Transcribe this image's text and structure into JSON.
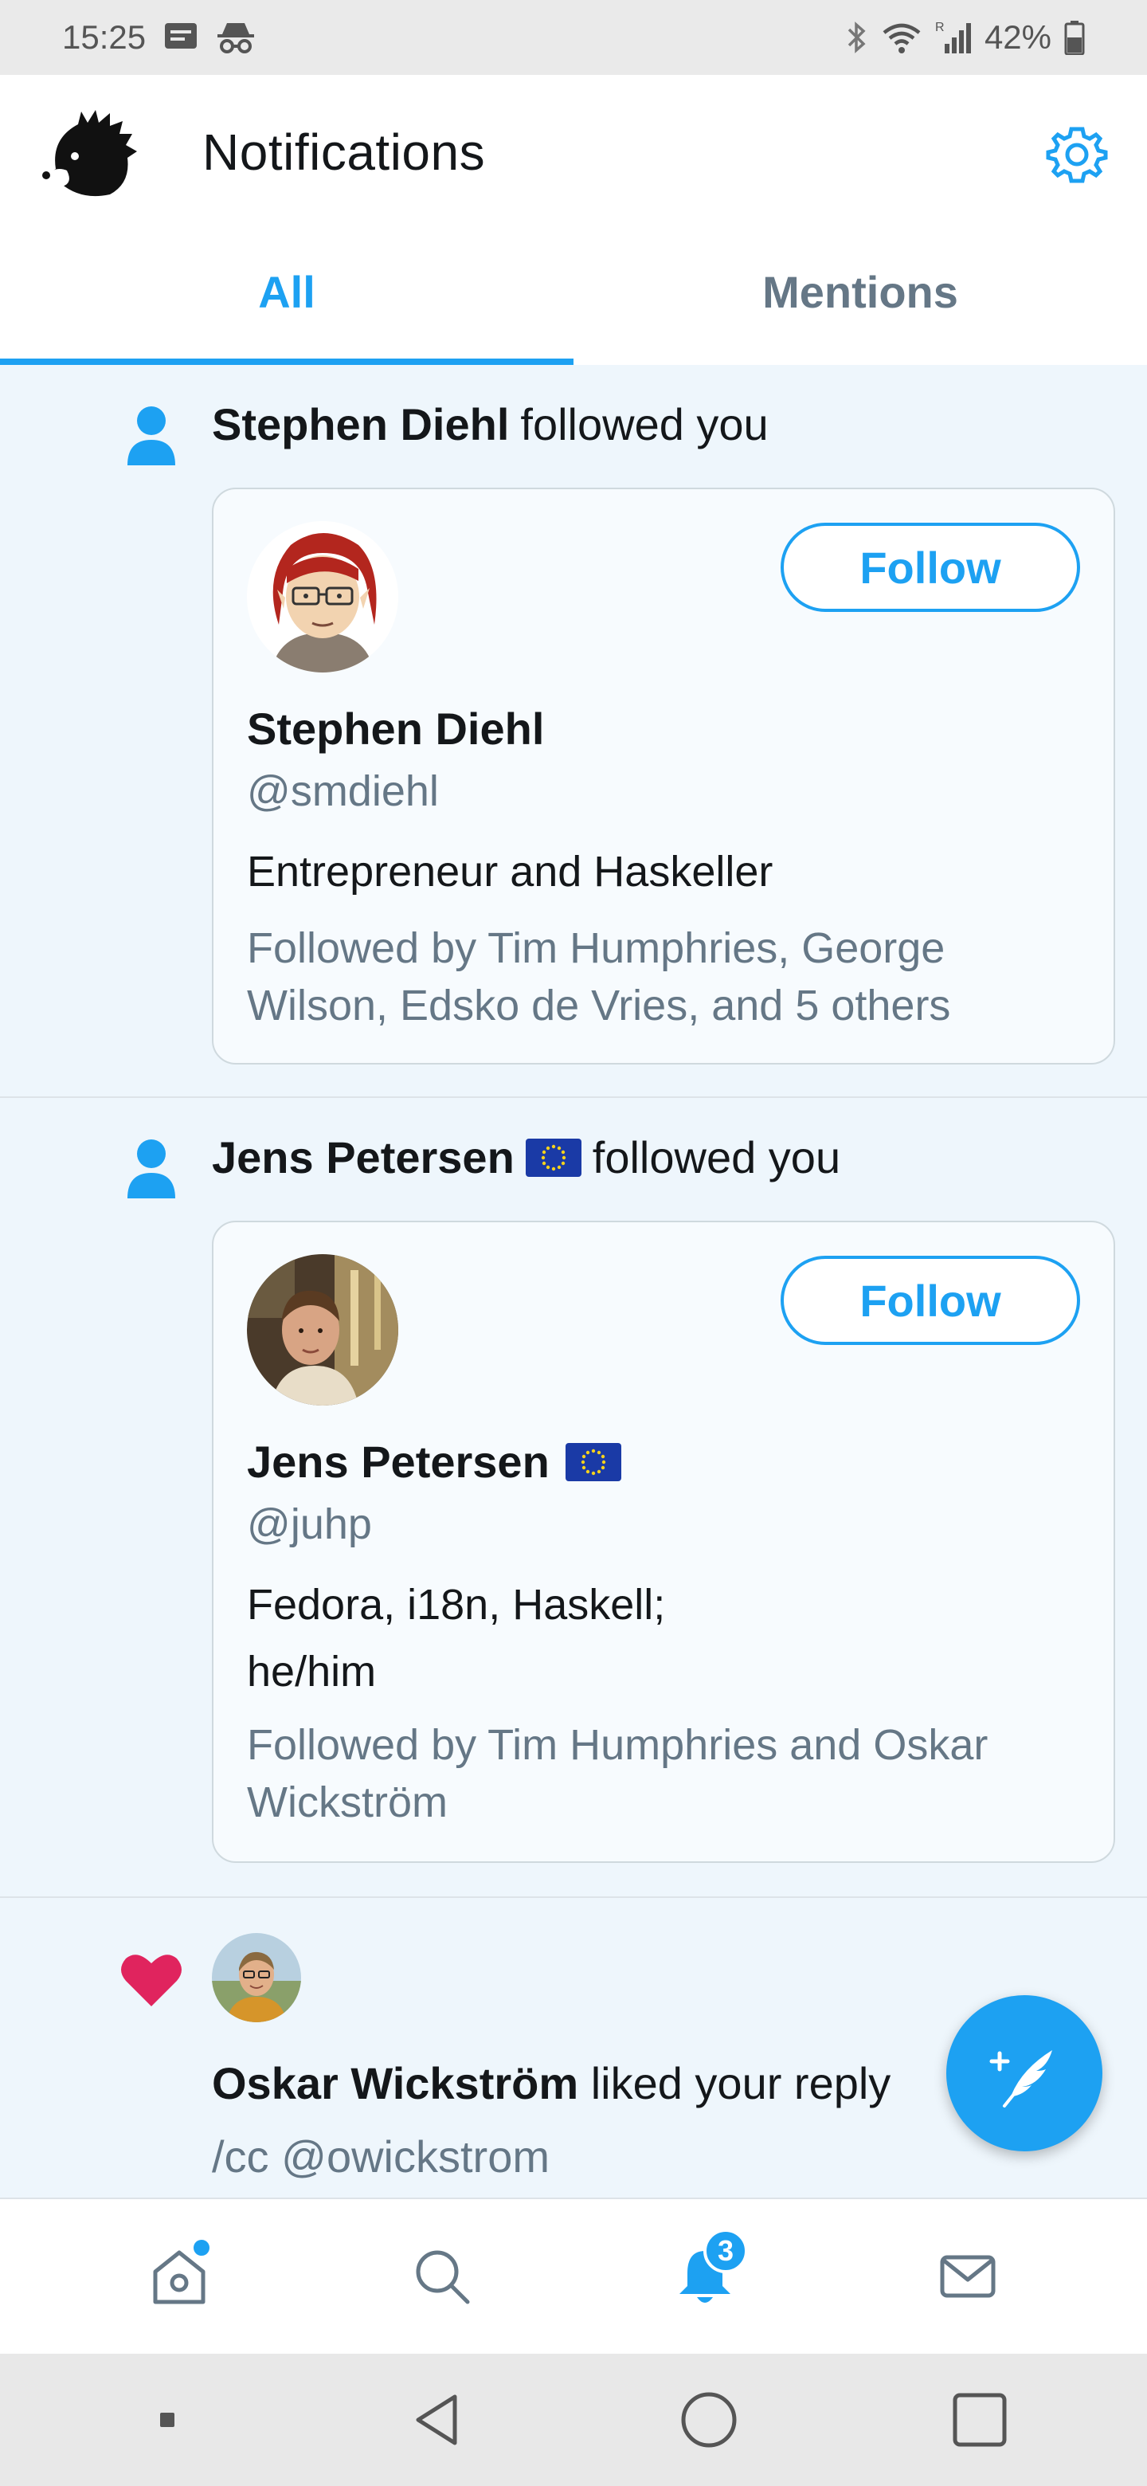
{
  "status_bar": {
    "time": "15:25",
    "battery": "42%",
    "network_label": "R"
  },
  "header": {
    "title": "Notifications"
  },
  "tabs": [
    {
      "label": "All",
      "active": true
    },
    {
      "label": "Mentions",
      "active": false
    }
  ],
  "notifications": [
    {
      "type": "follow",
      "user_name": "Stephen Diehl",
      "action_text": "followed you",
      "card": {
        "name": "Stephen Diehl",
        "handle": "@smdiehl",
        "bio": "Entrepreneur and Haskeller",
        "followed_by": "Followed by Tim Humphries, George Wilson, Edsko de Vries, and 5 others",
        "follow_label": "Follow"
      }
    },
    {
      "type": "follow",
      "user_name": "Jens Petersen",
      "action_text": "followed you",
      "card": {
        "name": "Jens Petersen",
        "handle": "@juhp",
        "bio_line1": "Fedora, i18n, Haskell;",
        "bio_line2": "he/him",
        "followed_by": "Followed by Tim Humphries and Oskar Wickström",
        "follow_label": "Follow"
      }
    },
    {
      "type": "like",
      "user_name": "Oskar Wickström",
      "action_text": "liked your reply",
      "text": "/cc @owickstrom"
    }
  ],
  "bottom_nav": {
    "notifications_badge": "3"
  },
  "colors": {
    "accent": "#1da1f2",
    "heart": "#e0245e",
    "feed_bg": "#eef6fc"
  }
}
